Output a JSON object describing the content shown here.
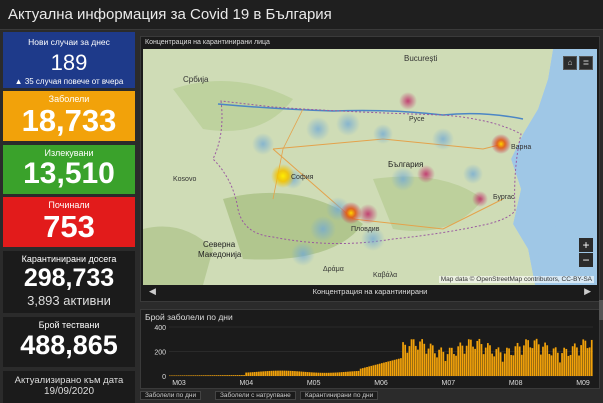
{
  "header": {
    "title": "Актуална информация за Covid 19 в България"
  },
  "cards": {
    "new_cases": {
      "label": "Нови случаи за днес",
      "value": "189",
      "note": "▲ 35 случая повече от вчера",
      "color": "#1e3a8a"
    },
    "infected": {
      "label": "Заболели",
      "value": "18,733",
      "color": "#f2a20a"
    },
    "recovered": {
      "label": "Излекувани",
      "value": "13,510",
      "color": "#3aa22b"
    },
    "deaths": {
      "label": "Починали",
      "value": "753",
      "color": "#e21b1b"
    },
    "quarantined": {
      "label": "Карантинирани досега",
      "value": "298,733",
      "active": "3,893 активни"
    },
    "tests": {
      "label": "Брой тествани",
      "value": "488,865"
    },
    "updated": {
      "label": "Актуализирано към дата",
      "date": "19/09/2020"
    }
  },
  "map": {
    "panel_title": "Концентрация на карантинирани лица",
    "nav_label": "Концентрация на карантинирани",
    "attribution": "Map data © OpenStreetMap contributors, CC-BY-SA",
    "home_icon": "home-icon",
    "list_icon": "list-icon",
    "zoom_in": "+",
    "zoom_out": "−",
    "places": {
      "bucuresti": "București",
      "serbia": "Србија",
      "ruse": "Русе",
      "varna": "Варна",
      "bulgaria": "България",
      "sofia": "София",
      "kosovo": "Kosovo",
      "plovdiv": "Пловдив",
      "burgas": "Бургас",
      "severna": "Северна",
      "makedonija": "Македонија",
      "drama": "Δράμα",
      "kavala": "Καβάλα"
    }
  },
  "chart_panel": {
    "title": "Брой заболели по дни"
  },
  "chart_data": {
    "type": "bar",
    "ylim": [
      0,
      400
    ],
    "yticks": [
      "0",
      "200",
      "400"
    ],
    "xticks": [
      "M03",
      "M04",
      "M05",
      "M06",
      "M07",
      "M08",
      "M09"
    ],
    "color": "#f2a20a"
  },
  "tabs": [
    "Заболели по дни",
    "Заболели с натрупване",
    "Карантинирани по дни"
  ]
}
